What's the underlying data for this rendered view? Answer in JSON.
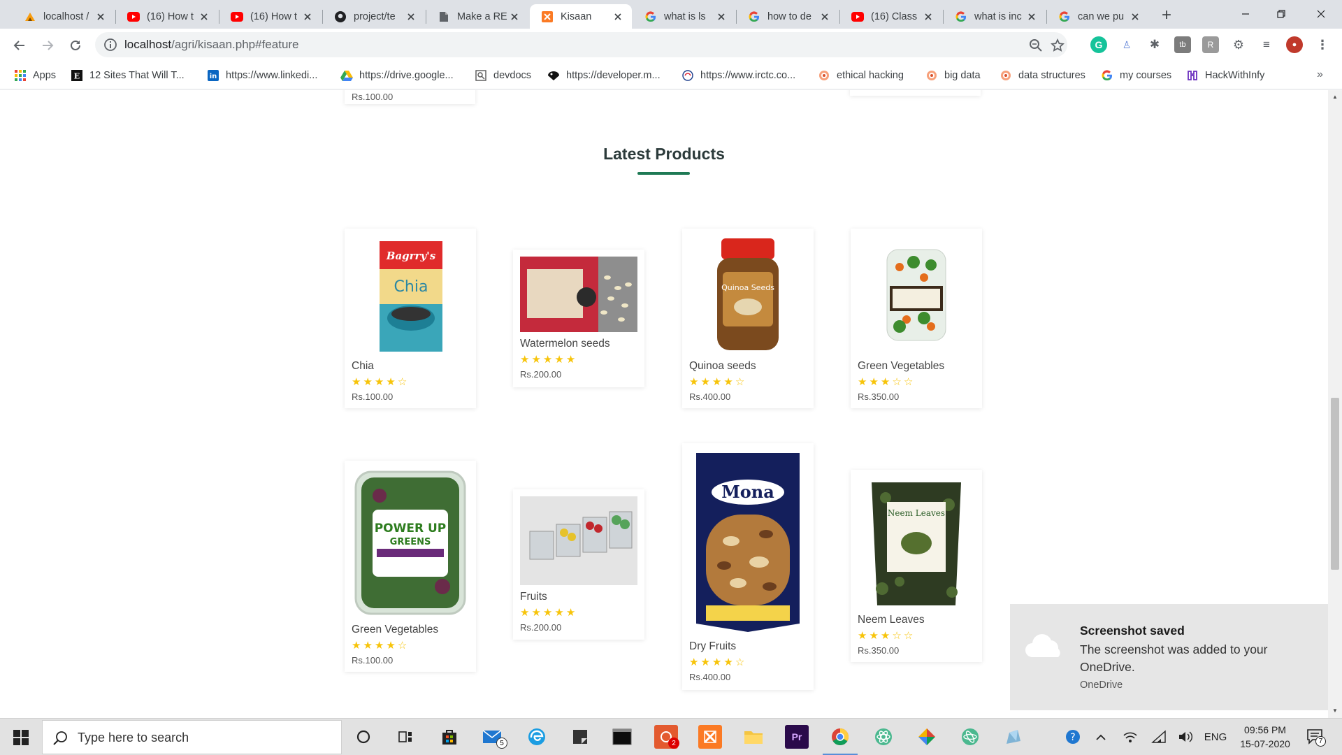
{
  "browser": {
    "tabs": [
      {
        "label": "localhost / ",
        "icon": "phpmyadmin-icon",
        "color": "#f89c0e"
      },
      {
        "label": "(16) How t",
        "icon": "youtube-icon",
        "color": "#ff0000"
      },
      {
        "label": "(16) How t",
        "icon": "youtube-icon",
        "color": "#ff0000"
      },
      {
        "label": "project/te",
        "icon": "github-icon",
        "color": "#202124"
      },
      {
        "label": "Make a RE",
        "icon": "document-icon",
        "color": "#5f6368"
      },
      {
        "label": "Kisaan",
        "icon": "xampp-icon",
        "color": "#fb7a24",
        "active": true
      },
      {
        "label": "what is ls",
        "icon": "google-icon",
        "color": "#4285f4"
      },
      {
        "label": "how to de",
        "icon": "google-icon",
        "color": "#4285f4"
      },
      {
        "label": "(16) Class",
        "icon": "youtube-icon",
        "color": "#ff0000"
      },
      {
        "label": "what is inc",
        "icon": "google-icon",
        "color": "#4285f4"
      },
      {
        "label": "can we pu",
        "icon": "google-icon",
        "color": "#4285f4"
      }
    ],
    "url_host": "localhost",
    "url_path": "/agri/kisaan.php#feature",
    "bookmarks": [
      {
        "label": "Apps",
        "icon": "apps-grid-icon"
      },
      {
        "label": "12 Sites That Will T...",
        "icon": "e-logo-icon"
      },
      {
        "label": "https://www.linkedi...",
        "icon": "linkedin-icon"
      },
      {
        "label": "https://drive.google...",
        "icon": "google-drive-icon"
      },
      {
        "label": "devdocs",
        "icon": "devdocs-icon"
      },
      {
        "label": "https://developer.m...",
        "icon": "mdn-icon"
      },
      {
        "label": "https://www.irctc.co...",
        "icon": "irctc-icon"
      },
      {
        "label": "ethical hacking",
        "icon": "course-icon"
      },
      {
        "label": "big data",
        "icon": "course-icon"
      },
      {
        "label": "data structures",
        "icon": "course-icon"
      },
      {
        "label": "my courses",
        "icon": "google-icon"
      },
      {
        "label": "HackWithInfy",
        "icon": "hackwithinfy-icon"
      }
    ],
    "bookmarks_more": "»"
  },
  "page": {
    "top_partial_price": "Rs.100.00",
    "section_title": "Latest Products",
    "accent_color": "#1f7a55",
    "star_color": "#f7c40a",
    "products": [
      {
        "name": "Chia",
        "rating": 4,
        "price": "Rs.100.00",
        "image": "chia-pack-image"
      },
      {
        "name": "Watermelon seeds",
        "rating": 5,
        "price": "Rs.200.00",
        "image": "watermelon-seeds-image"
      },
      {
        "name": "Quinoa seeds",
        "rating": 4,
        "price": "Rs.400.00",
        "image": "quinoa-jar-image"
      },
      {
        "name": "Green Vegetables",
        "rating": 3,
        "price": "Rs.350.00",
        "image": "vegetable-tray-image"
      },
      {
        "name": "Green Vegetables",
        "rating": 4,
        "price": "Rs.100.00",
        "image": "greens-box-image"
      },
      {
        "name": "Fruits",
        "rating": 5,
        "price": "Rs.200.00",
        "image": "fruit-boxes-image"
      },
      {
        "name": "Dry Fruits",
        "rating": 4,
        "price": "Rs.400.00",
        "image": "dry-fruits-bag-image"
      },
      {
        "name": "Neem Leaves",
        "rating": 3,
        "price": "Rs.350.00",
        "image": "neem-leaves-image"
      }
    ]
  },
  "toast": {
    "title": "Screenshot saved",
    "body": "The screenshot was added to your OneDrive.",
    "source": "OneDrive"
  },
  "taskbar": {
    "search_placeholder": "Type here to search",
    "language": "ENG",
    "time": "09:56 PM",
    "date": "15-07-2020",
    "mail_badge": "5",
    "app_badge": "2",
    "notification_count": "7"
  }
}
